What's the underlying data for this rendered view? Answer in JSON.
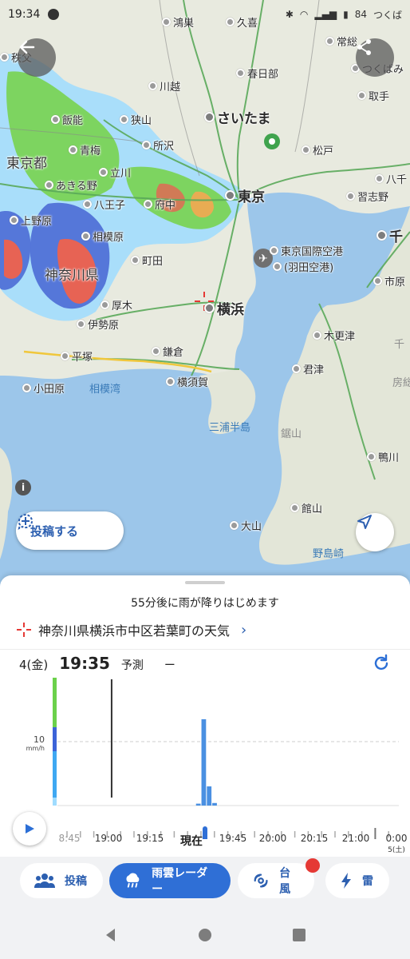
{
  "status_bar": {
    "time": "19:34",
    "right_text": "84",
    "notif_text": "つくば"
  },
  "map": {
    "places": [
      {
        "name": "鴻巣",
        "size": "normal"
      },
      {
        "name": "久喜",
        "size": "normal"
      },
      {
        "name": "常総",
        "size": "normal"
      },
      {
        "name": "秩父",
        "size": "normal"
      },
      {
        "name": "つくばみ",
        "size": "normal"
      },
      {
        "name": "春日部",
        "size": "normal"
      },
      {
        "name": "川越",
        "size": "normal"
      },
      {
        "name": "取手",
        "size": "normal"
      },
      {
        "name": "飯能",
        "size": "normal"
      },
      {
        "name": "狭山",
        "size": "normal"
      },
      {
        "name": "さいたま",
        "size": "big"
      },
      {
        "name": "所沢",
        "size": "normal"
      },
      {
        "name": "青梅",
        "size": "normal"
      },
      {
        "name": "松戸",
        "size": "normal"
      },
      {
        "name": "東京都",
        "size": "region"
      },
      {
        "name": "立川",
        "size": "normal"
      },
      {
        "name": "あきる野",
        "size": "normal"
      },
      {
        "name": "八千",
        "size": "normal"
      },
      {
        "name": "東京",
        "size": "big"
      },
      {
        "name": "習志野",
        "size": "normal"
      },
      {
        "name": "八王子",
        "size": "normal"
      },
      {
        "name": "府中",
        "size": "normal"
      },
      {
        "name": "上野原",
        "size": "normal"
      },
      {
        "name": "千",
        "size": "big"
      },
      {
        "name": "相模原",
        "size": "normal"
      },
      {
        "name": "東京国際空港",
        "size": "normal"
      },
      {
        "name": "(羽田空港)",
        "size": "normal"
      },
      {
        "name": "町田",
        "size": "normal"
      },
      {
        "name": "市原",
        "size": "normal"
      },
      {
        "name": "神奈川県",
        "size": "region"
      },
      {
        "name": "厚木",
        "size": "normal"
      },
      {
        "name": "横浜",
        "size": "big"
      },
      {
        "name": "伊勢原",
        "size": "normal"
      },
      {
        "name": "木更津",
        "size": "normal"
      },
      {
        "name": "鎌倉",
        "size": "normal"
      },
      {
        "name": "平塚",
        "size": "normal"
      },
      {
        "name": "君津",
        "size": "normal"
      },
      {
        "name": "横須賀",
        "size": "normal"
      },
      {
        "name": "小田原",
        "size": "normal"
      },
      {
        "name": "相模湾",
        "size": "water"
      },
      {
        "name": "房総",
        "size": "dim"
      },
      {
        "name": "三浦半島",
        "size": "water"
      },
      {
        "name": "鋸山",
        "size": "dim"
      },
      {
        "name": "鴨川",
        "size": "normal"
      },
      {
        "name": "館山",
        "size": "normal"
      },
      {
        "name": "大山",
        "size": "normal"
      },
      {
        "name": "野島崎",
        "size": "water"
      },
      {
        "name": "千",
        "size": "dim"
      }
    ],
    "post_button_label": "投稿する",
    "info_label": "i"
  },
  "sheet": {
    "message": "55分後に雨が降りはじめます",
    "location": "神奈川県横浜市中区若葉町の天気",
    "date": "4(金)",
    "time": "19:35",
    "forecast_label": "予測",
    "forecast_value": "ー"
  },
  "chart_data": {
    "type": "bar",
    "ylabel": "mm/h",
    "y_tick_label": "10",
    "y_tick_value": 10,
    "ylim": [
      0,
      20
    ],
    "x_start": "18:45",
    "x_end": "00:00",
    "step_minutes": 5,
    "current_time": "19:35",
    "values": [
      {
        "time": "20:55",
        "value": 0.3
      },
      {
        "time": "21:00",
        "value": 13.5
      },
      {
        "time": "21:05",
        "value": 3.0
      },
      {
        "time": "21:10",
        "value": 0.4
      }
    ],
    "legend_colors": [
      "#6bd14b",
      "#3c63d8",
      "#3fa8f2",
      "#9fdcff"
    ]
  },
  "timeline": {
    "labels": [
      "8:45",
      "19:00",
      "19:15",
      "現在",
      "19:45",
      "20:00",
      "20:15",
      "21:00",
      "0:00"
    ],
    "sub_label": "5(土)"
  },
  "nav": {
    "chips": [
      {
        "label": "投稿",
        "icon": "people-icon",
        "active": false
      },
      {
        "label": "雨雲レーダー",
        "icon": "rain-cloud-icon",
        "active": true
      },
      {
        "label": "台風",
        "icon": "typhoon-icon",
        "active": false
      },
      {
        "label": "雷",
        "icon": "lightning-icon",
        "active": false
      }
    ]
  },
  "colors": {
    "accent": "#2f6fd6",
    "water": "#9cc6ea",
    "land": "#e8eadf",
    "rain_light": "#9fdcff",
    "rain_mid": "#3c63d8",
    "rain_green": "#6bd14b",
    "rain_heavy": "#e74c3c"
  }
}
